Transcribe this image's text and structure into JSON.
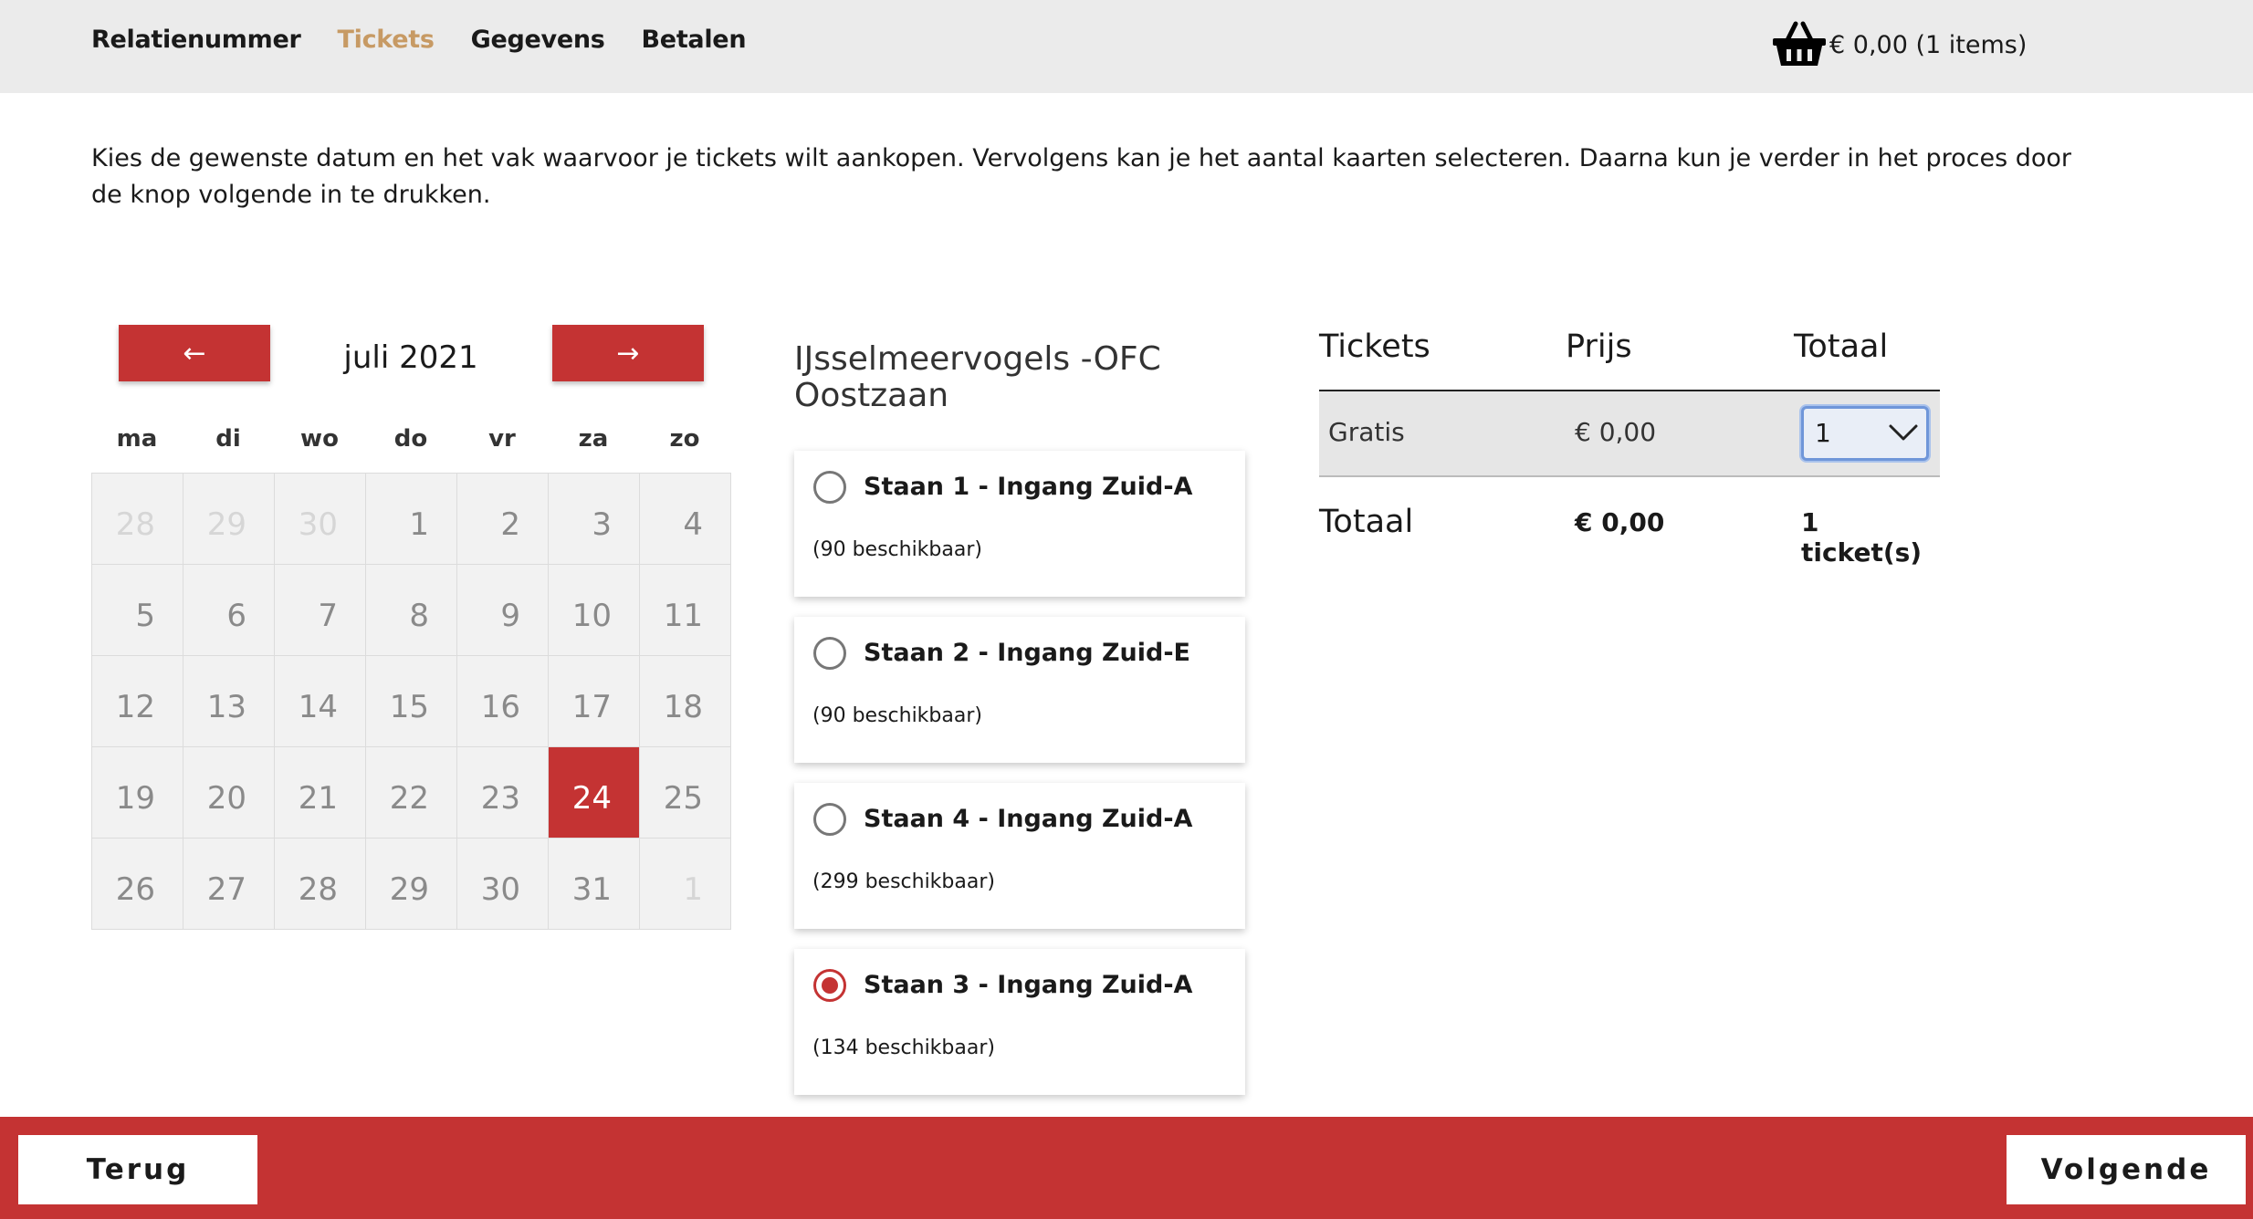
{
  "nav": {
    "items": [
      {
        "label": "Relatienummer",
        "active": false
      },
      {
        "label": "Tickets",
        "active": true
      },
      {
        "label": "Gegevens",
        "active": false
      },
      {
        "label": "Betalen",
        "active": false
      }
    ]
  },
  "cart": {
    "icon": "basket-icon",
    "text": "€ 0,00 (1 items)"
  },
  "intro": "Kies de gewenste datum en het vak waarvoor je tickets wilt aankopen. Vervolgens kan je het aantal kaarten selecteren. Daarna kun je verder in het proces door de knop volgende in te drukken.",
  "calendar": {
    "prev_label": "←",
    "next_label": "→",
    "month": "juli 2021",
    "weekdays": [
      "ma",
      "di",
      "wo",
      "do",
      "vr",
      "za",
      "zo"
    ],
    "days": [
      {
        "d": "28",
        "muted": true
      },
      {
        "d": "29",
        "muted": true
      },
      {
        "d": "30",
        "muted": true
      },
      {
        "d": "1"
      },
      {
        "d": "2"
      },
      {
        "d": "3"
      },
      {
        "d": "4"
      },
      {
        "d": "5"
      },
      {
        "d": "6"
      },
      {
        "d": "7"
      },
      {
        "d": "8"
      },
      {
        "d": "9"
      },
      {
        "d": "10"
      },
      {
        "d": "11"
      },
      {
        "d": "12"
      },
      {
        "d": "13"
      },
      {
        "d": "14"
      },
      {
        "d": "15"
      },
      {
        "d": "16"
      },
      {
        "d": "17"
      },
      {
        "d": "18"
      },
      {
        "d": "19"
      },
      {
        "d": "20"
      },
      {
        "d": "21"
      },
      {
        "d": "22"
      },
      {
        "d": "23"
      },
      {
        "d": "24",
        "selected": true
      },
      {
        "d": "25"
      },
      {
        "d": "26"
      },
      {
        "d": "27"
      },
      {
        "d": "28"
      },
      {
        "d": "29"
      },
      {
        "d": "30"
      },
      {
        "d": "31"
      },
      {
        "d": "1",
        "muted": true
      }
    ]
  },
  "match": {
    "title": "IJsselmeervogels -OFC Oostzaan"
  },
  "sections": [
    {
      "name": "Staan 1 - Ingang Zuid-A",
      "availability": "(90 beschikbaar)",
      "selected": false
    },
    {
      "name": "Staan 2 - Ingang Zuid-E",
      "availability": "(90 beschikbaar)",
      "selected": false
    },
    {
      "name": "Staan 4 - Ingang Zuid-A",
      "availability": "(299 beschikbaar)",
      "selected": false
    },
    {
      "name": "Staan 3 - Ingang Zuid-A",
      "availability": "(134 beschikbaar)",
      "selected": true
    }
  ],
  "tickets": {
    "headers": {
      "tickets": "Tickets",
      "price": "Prijs",
      "total": "Totaal"
    },
    "row": {
      "type": "Gratis",
      "price": "€ 0,00",
      "quantity": "1"
    },
    "summary": {
      "label": "Totaal",
      "price": "€ 0,00",
      "count": "1 ticket(s)"
    }
  },
  "footer": {
    "back_label": "Terug",
    "next_label": "Volgende"
  },
  "colors": {
    "accent": "#c43333",
    "active_nav": "#c79a64",
    "topbar": "#ebebeb"
  }
}
